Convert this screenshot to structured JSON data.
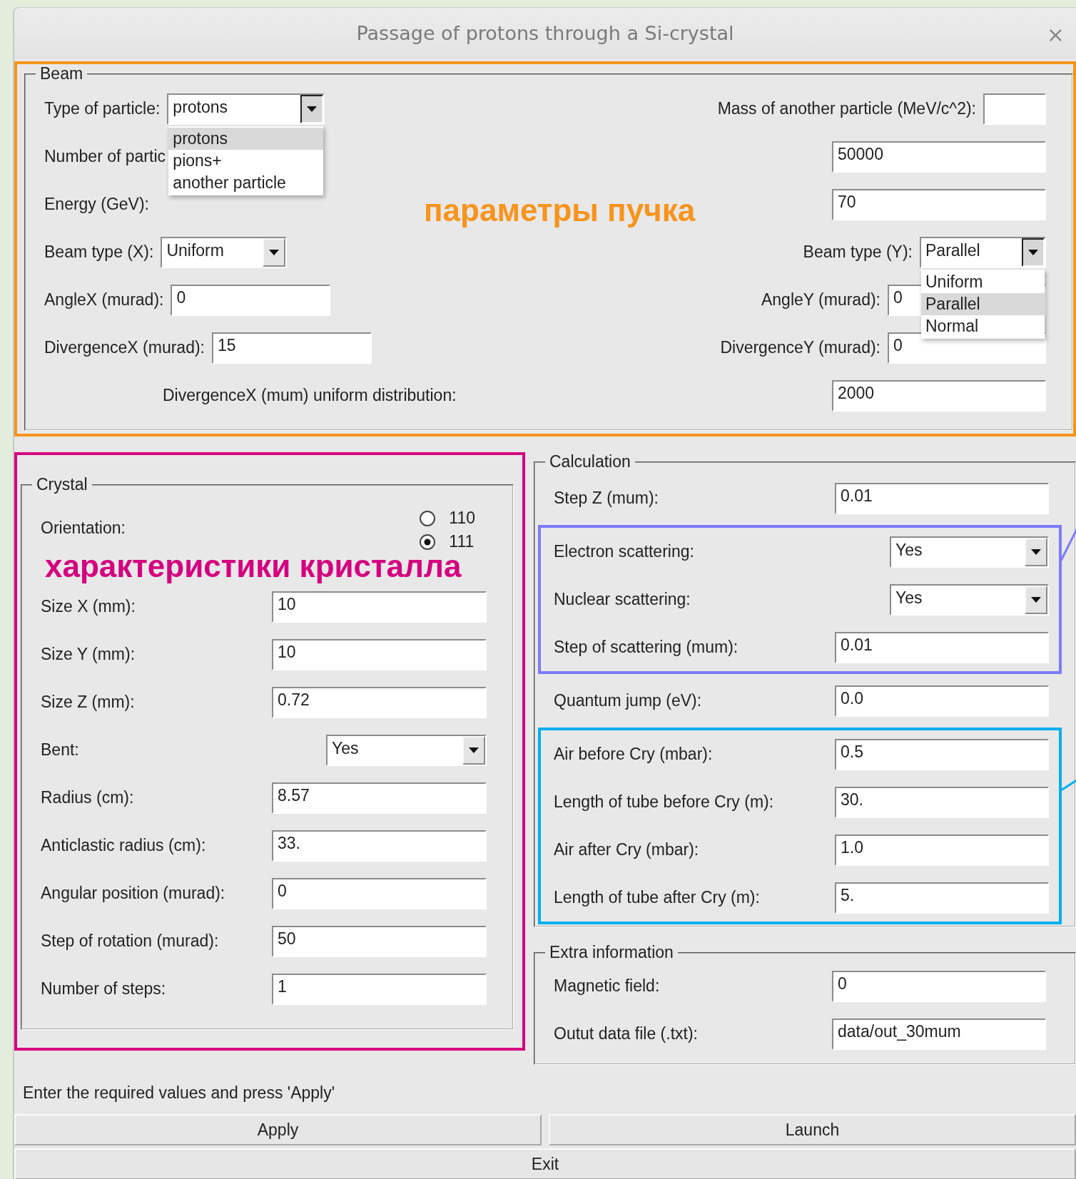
{
  "window": {
    "title": "Passage of protons through a Si-crystal",
    "close": "×"
  },
  "beam": {
    "title": "Beam",
    "annotation": {
      "text": "параметры пучка",
      "color": "#f7941d"
    },
    "rows": [
      {
        "kind": "split",
        "left": {
          "label": "Type of particle:",
          "control": {
            "kind": "combo",
            "value": "protons",
            "open": true,
            "options": [
              {
                "label": "protons",
                "selected": true
              },
              {
                "label": "pions+",
                "selected": false
              },
              {
                "label": "another particle",
                "selected": false
              }
            ]
          }
        },
        "right": {
          "label": "Mass of another particle (MeV/c^2):",
          "control": {
            "kind": "field"
          }
        }
      },
      {
        "kind": "split",
        "left": {
          "label": "Number of partic"
        },
        "right": {
          "control": {
            "kind": "field",
            "value": "50000"
          }
        }
      },
      {
        "kind": "split",
        "left": {
          "label": "Energy (GeV):"
        },
        "right": {
          "control": {
            "kind": "field",
            "value": "70"
          }
        }
      },
      {
        "kind": "split",
        "left": {
          "label": "Beam type (X):",
          "control": {
            "kind": "combo",
            "value": "Uniform",
            "open": false
          }
        },
        "right": {
          "label": "Beam type (Y):",
          "control": {
            "kind": "combo",
            "value": "Parallel",
            "open": true,
            "options": [
              {
                "label": "Uniform",
                "selected": false
              },
              {
                "label": "Parallel",
                "selected": true
              },
              {
                "label": "Normal",
                "selected": false
              }
            ]
          }
        }
      },
      {
        "kind": "split",
        "left": {
          "label": "AngleX (murad):",
          "control": {
            "kind": "field",
            "value": "0"
          }
        },
        "right": {
          "label": "AngleY (murad):",
          "control": {
            "kind": "field",
            "value": "0"
          }
        }
      },
      {
        "kind": "split",
        "left": {
          "label": "DivergenceX (murad):",
          "control": {
            "kind": "field",
            "value": "15"
          }
        },
        "right": {
          "label": "DivergenceY (murad):",
          "control": {
            "kind": "field",
            "value": "0"
          }
        }
      },
      {
        "kind": "span",
        "left": {
          "label": "DivergenceX (mum) uniform distribution:"
        },
        "right": {
          "control": {
            "kind": "field",
            "value": "2000"
          }
        }
      }
    ]
  },
  "crystal": {
    "title": "Crystal",
    "annotation": {
      "text": "характеристики кристалла",
      "color": "#d4007f"
    },
    "rows": [
      {
        "label": "Orientation:",
        "control": {
          "kind": "radio",
          "options": [
            {
              "label": "110",
              "selected": false
            },
            {
              "label": "111",
              "selected": true
            }
          ]
        }
      },
      {
        "label": "Size X (mm):",
        "control": {
          "kind": "field",
          "value": "10"
        }
      },
      {
        "label": "Size Y (mm):",
        "control": {
          "kind": "field",
          "value": "10"
        }
      },
      {
        "label": "Size Z (mm):",
        "control": {
          "kind": "field",
          "value": "0.72"
        }
      },
      {
        "label": "Bent:",
        "control": {
          "kind": "combo",
          "value": "Yes",
          "open": false
        }
      },
      {
        "label": "Radius (cm):",
        "control": {
          "kind": "field",
          "value": "8.57"
        }
      },
      {
        "label": "Anticlastic radius (cm):",
        "control": {
          "kind": "field",
          "value": "33."
        }
      },
      {
        "label": "Angular position (murad):",
        "control": {
          "kind": "field",
          "value": "0"
        }
      },
      {
        "label": "Step of rotation (murad):",
        "control": {
          "kind": "field",
          "value": "50"
        }
      },
      {
        "label": "Number of steps:",
        "control": {
          "kind": "field",
          "value": "1"
        }
      }
    ]
  },
  "calculation": {
    "title": "Calculation",
    "groups": [
      {
        "rows": [
          {
            "label": "Step Z (mum):",
            "control": {
              "kind": "field",
              "value": "0.01"
            }
          }
        ]
      },
      {
        "color": "#7b7bff",
        "rows": [
          {
            "label": "Electron scattering:",
            "control": {
              "kind": "combo",
              "value": "Yes",
              "open": false
            }
          },
          {
            "label": "Nuclear scattering:",
            "control": {
              "kind": "combo",
              "value": "Yes",
              "open": false
            }
          },
          {
            "label": "Step of scattering (mum):",
            "control": {
              "kind": "field",
              "value": "0.01"
            }
          }
        ]
      },
      {
        "rows": [
          {
            "label": "Quantum jump (eV):",
            "control": {
              "kind": "field",
              "value": "0.0"
            }
          }
        ]
      },
      {
        "color": "#00aeef",
        "rows": [
          {
            "label": "Air before Cry (mbar):",
            "control": {
              "kind": "field",
              "value": "0.5"
            }
          },
          {
            "label": "Length of tube before Cry (m):",
            "control": {
              "kind": "field",
              "value": "30."
            }
          },
          {
            "label": "Air after Cry (mbar):",
            "control": {
              "kind": "field",
              "value": "1.0"
            }
          },
          {
            "label": "Length of tube after Cry (m):",
            "control": {
              "kind": "field",
              "value": "5."
            }
          }
        ]
      }
    ]
  },
  "extra": {
    "title": "Extra information",
    "rows": [
      {
        "label": "Magnetic field:",
        "control": {
          "kind": "field",
          "value": "0"
        }
      },
      {
        "label": "Outut data file (.txt):",
        "control": {
          "kind": "field",
          "value": "data/out_30mum"
        }
      }
    ]
  },
  "status": "Enter the required values and press 'Apply'",
  "buttons": [
    "Apply",
    "Launch"
  ],
  "exit": "Exit"
}
